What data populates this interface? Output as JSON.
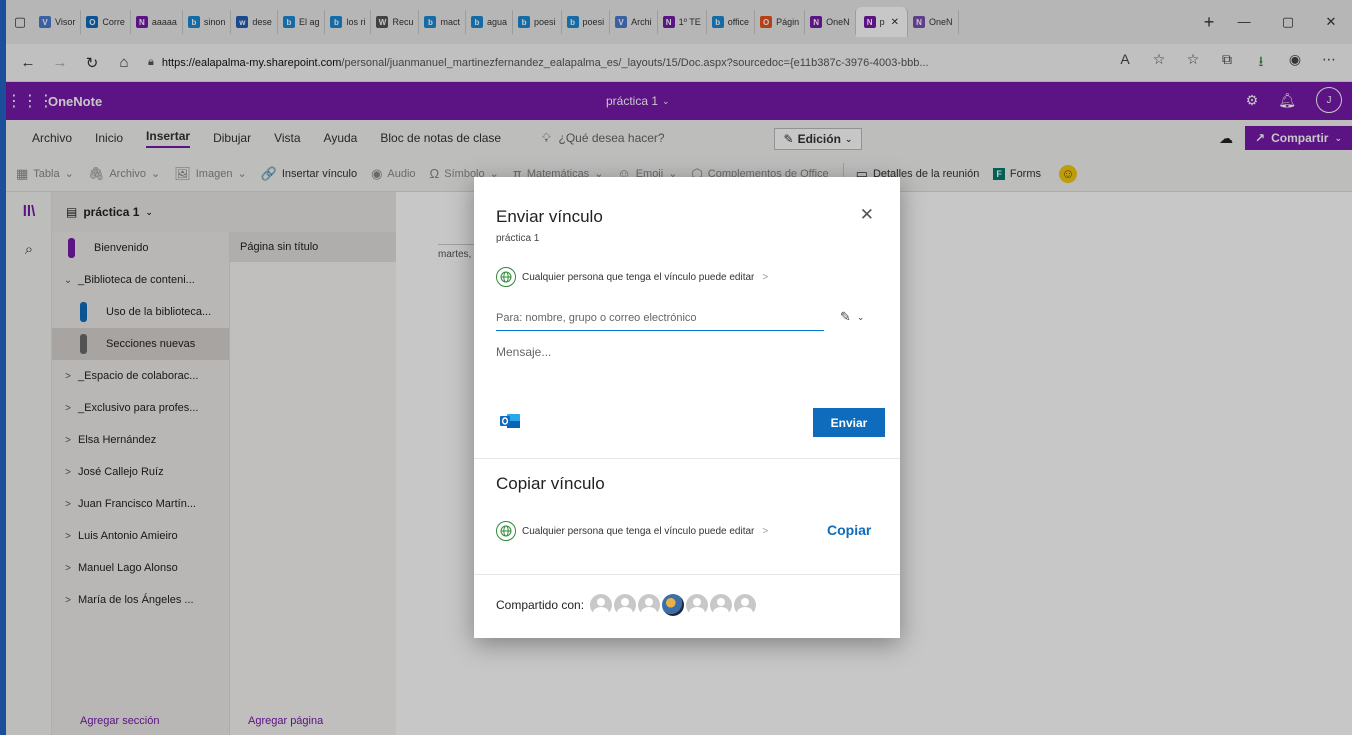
{
  "browser": {
    "tabs": [
      {
        "label": "Visor",
        "color": "#4a7bd1",
        "glyph": "V"
      },
      {
        "label": "Corre",
        "color": "#0f6cbd",
        "glyph": "O"
      },
      {
        "label": "aaaaa",
        "color": "#7719aa",
        "glyph": "N"
      },
      {
        "label": "sinon",
        "color": "#1a8ad4",
        "glyph": "b"
      },
      {
        "label": "dese",
        "color": "#1f5fb5",
        "glyph": "w"
      },
      {
        "label": "El ag",
        "color": "#1a8ad4",
        "glyph": "b"
      },
      {
        "label": "los ri",
        "color": "#1a8ad4",
        "glyph": "b"
      },
      {
        "label": "Recu",
        "color": "#555555",
        "glyph": "W"
      },
      {
        "label": "mact",
        "color": "#1a8ad4",
        "glyph": "b"
      },
      {
        "label": "agua",
        "color": "#1a8ad4",
        "glyph": "b"
      },
      {
        "label": "poesi",
        "color": "#1a8ad4",
        "glyph": "b"
      },
      {
        "label": "poesi",
        "color": "#1a8ad4",
        "glyph": "b"
      },
      {
        "label": "Archi",
        "color": "#4a7bd1",
        "glyph": "V"
      },
      {
        "label": "1º TE",
        "color": "#7719aa",
        "glyph": "N"
      },
      {
        "label": "office",
        "color": "#1a8ad4",
        "glyph": "b"
      },
      {
        "label": "Págin",
        "color": "#e8521f",
        "glyph": "O"
      },
      {
        "label": "OneN",
        "color": "#7719aa",
        "glyph": "N"
      },
      {
        "label": "p",
        "color": "#7719aa",
        "glyph": "N",
        "active": true
      },
      {
        "label": "OneN",
        "color": "#7a4fb5",
        "glyph": "N"
      }
    ],
    "url_host": "https://ealapalma-my.sharepoint.com",
    "url_path": "/personal/juanmanuel_martinezfernandez_ealapalma_es/_layouts/15/Doc.aspx?sourcedoc={e11b387c-3976-4003-bbb..."
  },
  "app": {
    "name": "OneNote",
    "doc_title": "práctica 1",
    "user_initial": "J"
  },
  "menu": {
    "items": [
      "Archivo",
      "Inicio",
      "Insertar",
      "Dibujar",
      "Vista",
      "Ayuda",
      "Bloc de notas de clase"
    ],
    "search": "¿Qué desea hacer?",
    "edit": "Edición",
    "share": "Compartir"
  },
  "ribbon": {
    "items": [
      {
        "label": "Tabla",
        "icon": "▦",
        "enabled": false,
        "caret": true
      },
      {
        "label": "Archivo",
        "icon": "🖇",
        "enabled": false,
        "caret": true
      },
      {
        "label": "Imagen",
        "icon": "🖼",
        "enabled": false,
        "caret": true
      },
      {
        "label": "Insertar vínculo",
        "icon": "🔗",
        "enabled": true,
        "caret": false
      },
      {
        "label": "Audio",
        "icon": "◉",
        "enabled": false,
        "caret": false
      },
      {
        "label": "Símbolo",
        "icon": "Ω",
        "enabled": false,
        "caret": true
      },
      {
        "label": "Matemáticas",
        "icon": "π",
        "enabled": false,
        "caret": true
      },
      {
        "label": "Emoji",
        "icon": "☺",
        "enabled": false,
        "caret": true
      },
      {
        "label": "Complementos de Office",
        "icon": "⬡",
        "enabled": false,
        "caret": false
      },
      {
        "label": "Detalles de la reunión",
        "icon": "▭",
        "enabled": true,
        "caret": false
      },
      {
        "label": "Forms",
        "icon": "F",
        "enabled": true,
        "caret": false
      }
    ]
  },
  "notebook": {
    "name": "práctica 1",
    "sections": [
      {
        "label": "Bienvenido",
        "type": "section",
        "color": "#7719aa"
      },
      {
        "label": "_Biblioteca de conteni...",
        "type": "group",
        "expanded": true
      },
      {
        "label": "Uso de la biblioteca...",
        "type": "section",
        "color": "#0f6cbd",
        "indent": true
      },
      {
        "label": "Secciones nuevas",
        "type": "section",
        "color": "#6b6b6b",
        "indent": true,
        "selected": true
      },
      {
        "label": "_Espacio de colaborac...",
        "type": "group"
      },
      {
        "label": "_Exclusivo para profes...",
        "type": "group"
      },
      {
        "label": "Elsa Hernández",
        "type": "group"
      },
      {
        "label": "José Callejo Ruíz",
        "type": "group"
      },
      {
        "label": "Juan Francisco Martín...",
        "type": "group"
      },
      {
        "label": "Luis Antonio Amieiro",
        "type": "group"
      },
      {
        "label": "Manuel Lago Alonso",
        "type": "group"
      },
      {
        "label": "María de los Ángeles ...",
        "type": "group"
      }
    ],
    "add_section": "Agregar sección",
    "pages": [
      "Página sin título"
    ],
    "add_page": "Agregar página",
    "page_date": "martes,"
  },
  "dialog": {
    "title": "Enviar vínculo",
    "subtitle": "práctica 1",
    "permission": "Cualquier persona que tenga el vínculo puede editar",
    "to_placeholder": "Para: nombre, grupo o correo electrónico",
    "message_placeholder": "Mensaje...",
    "send": "Enviar",
    "copy_title": "Copiar vínculo",
    "copy_permission": "Cualquier persona que tenga el vínculo puede editar",
    "copy": "Copiar",
    "shared_with": "Compartido con:",
    "shared_avatars": 7,
    "photo_avatar_index": 3
  }
}
